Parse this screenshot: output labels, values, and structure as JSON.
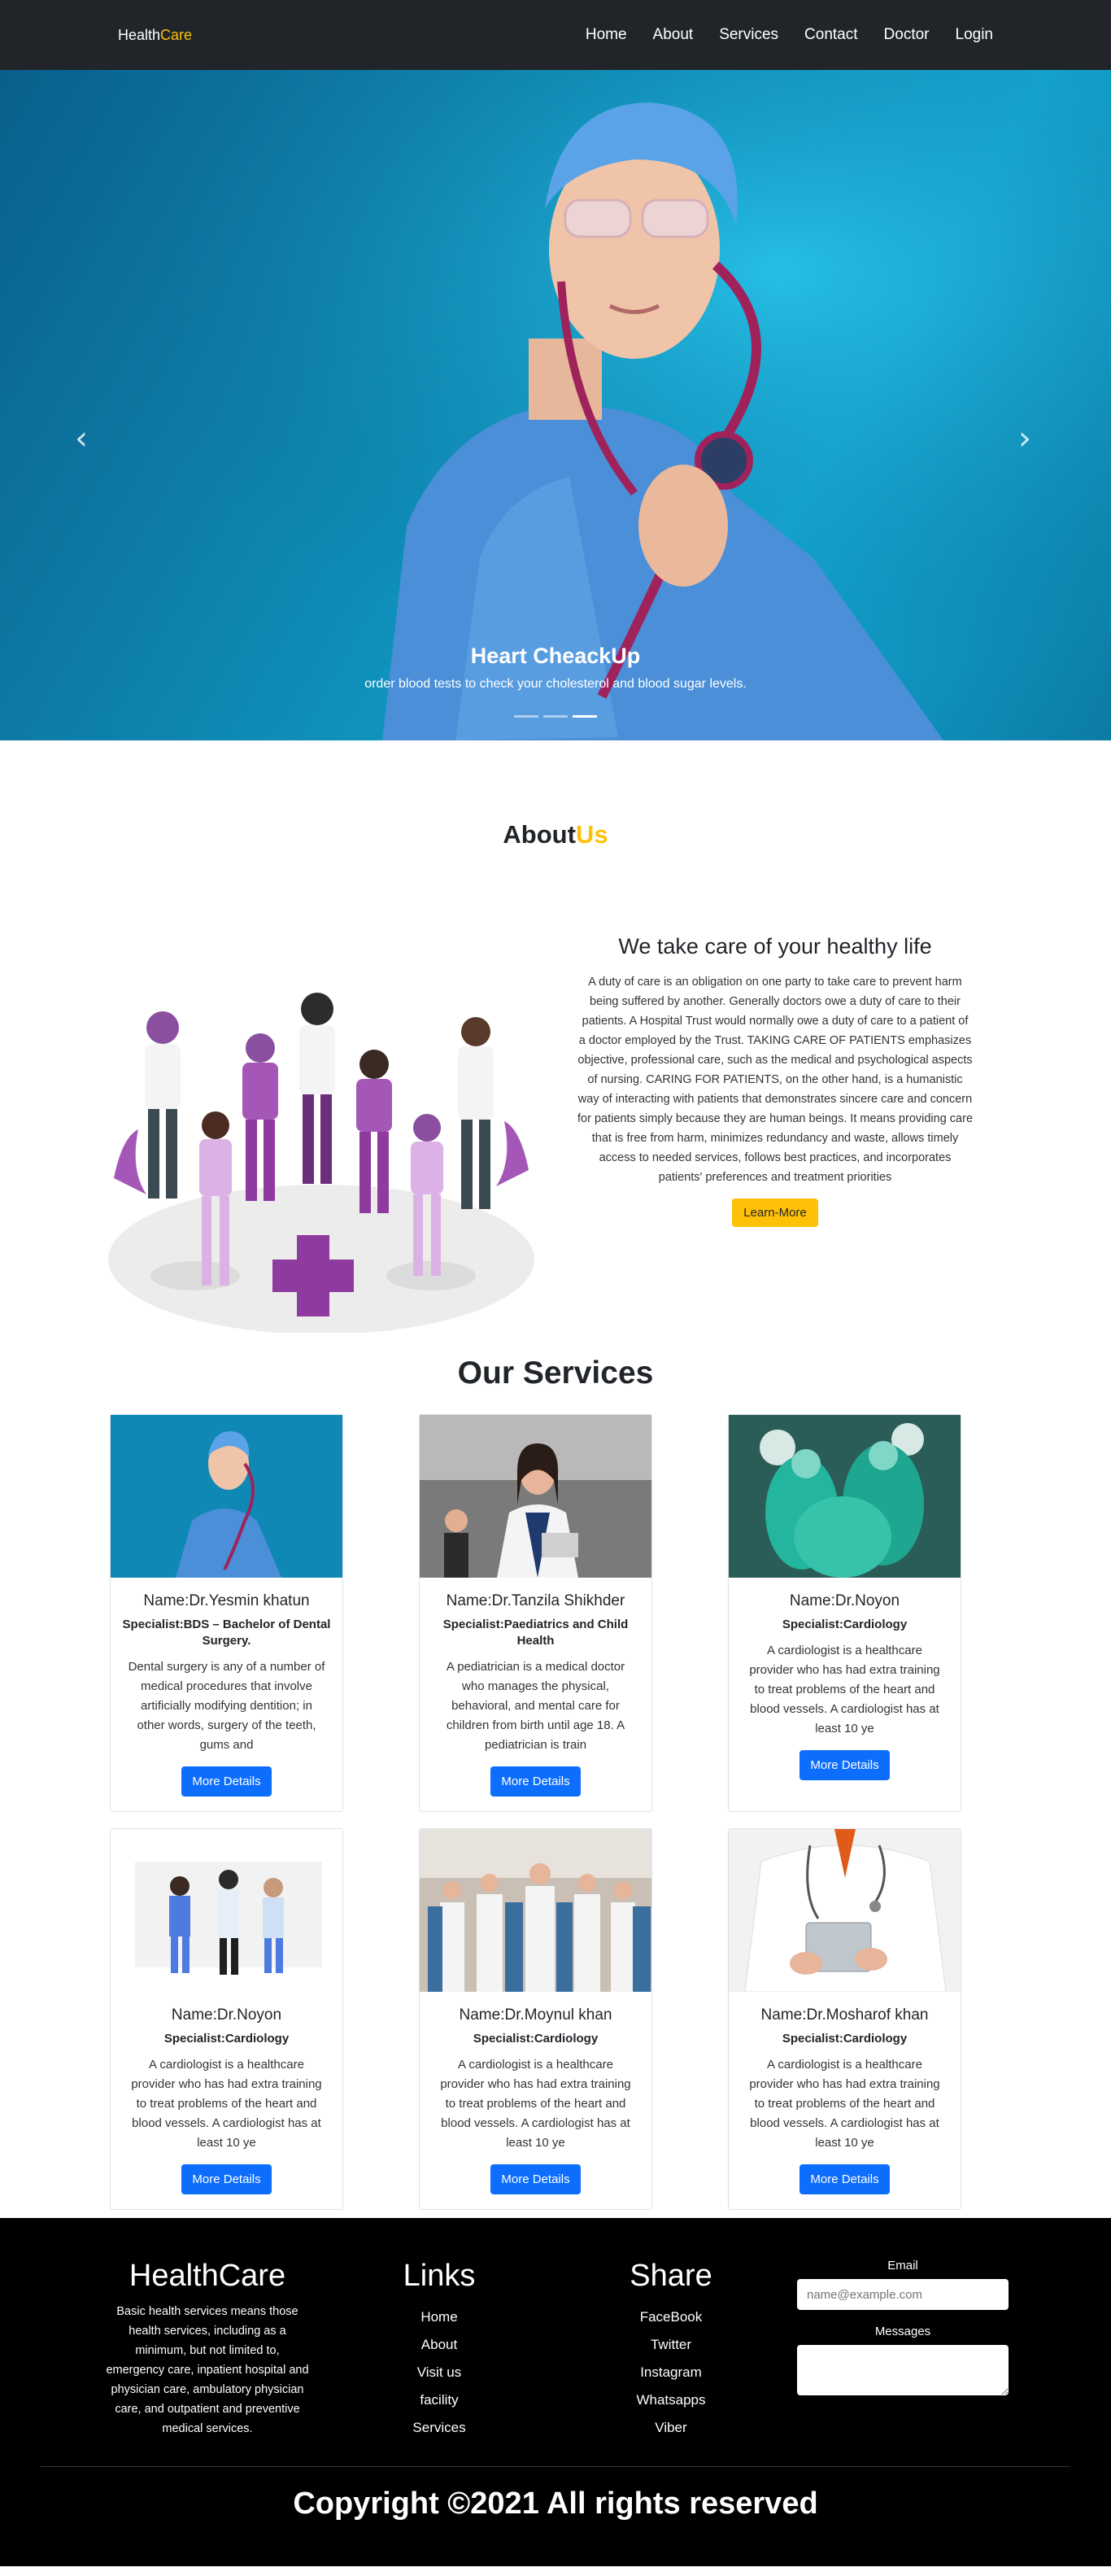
{
  "nav": {
    "brand_part1": "Health",
    "brand_part2": "Care",
    "links": [
      "Home",
      "About",
      "Services",
      "Contact",
      "Doctor",
      "Login"
    ]
  },
  "hero": {
    "caption_title": "Heart CheackUp",
    "caption_text": "order blood tests to check your cholesterol and blood sugar levels.",
    "slides": 3,
    "active_slide": 3
  },
  "about": {
    "title_part1": "About",
    "title_part2": "Us",
    "heading": "We take care of your healthy life",
    "body": "A duty of care is an obligation on one party to take care to prevent harm being suffered by another. Generally doctors owe a duty of care to their patients. A Hospital Trust would normally owe a duty of care to a patient of a doctor employed by the Trust. TAKING CARE OF PATIENTS emphasizes objective, professional care, such as the medical and psychological aspects of nursing. CARING FOR PATIENTS, on the other hand, is a humanistic way of interacting with patients that demonstrates sincere care and concern for patients simply because they are human beings. It means providing care that is free from harm, minimizes redundancy and waste, allows timely access to needed services, follows best practices, and incorporates patients' preferences and treatment priorities",
    "button": "Learn-More"
  },
  "services": {
    "title": "Our Services",
    "button_label": "More Details",
    "cards": [
      {
        "name": "Name:Dr.Yesmin khatun",
        "specialist": "Specialist:BDS – Bachelor of Dental Surgery.",
        "desc": "Dental surgery is any of a number of medical procedures that involve artificially modifying dentition; in other words, surgery of the teeth, gums and"
      },
      {
        "name": "Name:Dr.Tanzila Shikhder",
        "specialist": "Specialist:Paediatrics and Child Health",
        "desc": "A pediatrician is a medical doctor who manages the physical, behavioral, and mental care for children from birth until age 18. A pediatrician is train"
      },
      {
        "name": "Name:Dr.Noyon",
        "specialist": "Specialist:Cardiology",
        "desc": "A cardiologist is a healthcare provider who has had extra training to treat problems of the heart and blood vessels. A cardiologist has at least 10 ye"
      },
      {
        "name": "Name:Dr.Noyon",
        "specialist": "Specialist:Cardiology",
        "desc": "A cardiologist is a healthcare provider who has had extra training to treat problems of the heart and blood vessels. A cardiologist has at least 10 ye"
      },
      {
        "name": "Name:Dr.Moynul khan",
        "specialist": "Specialist:Cardiology",
        "desc": "A cardiologist is a healthcare provider who has had extra training to treat problems of the heart and blood vessels. A cardiologist has at least 10 ye"
      },
      {
        "name": "Name:Dr.Mosharof khan",
        "specialist": "Specialist:Cardiology",
        "desc": "A cardiologist is a healthcare provider who has had extra training to treat problems of the heart and blood vessels. A cardiologist has at least 10 ye"
      }
    ]
  },
  "footer": {
    "brand": "HealthCare",
    "brand_desc": "Basic health services means those health services, including as a minimum, but not limited to, emergency care, inpatient hospital and physician care, ambulatory physician care, and outpatient and preventive medical services.",
    "links_title": "Links",
    "links": [
      "Home",
      "About",
      "Visit us",
      "facility",
      "Services"
    ],
    "share_title": "Share",
    "share": [
      "FaceBook",
      "Twitter",
      "Instagram",
      "Whatsapps",
      "Viber"
    ],
    "email_label": "Email",
    "email_placeholder": "name@example.com",
    "messages_label": "Messages",
    "copyright": "Copyright ©2021 All rights reserved"
  },
  "colors": {
    "accent": "#ffc107",
    "primary": "#0d6efd",
    "navbar": "#212529",
    "footer": "#000000"
  }
}
